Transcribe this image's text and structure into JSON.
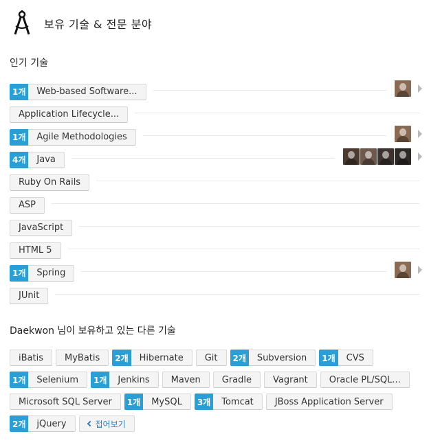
{
  "header": {
    "title": "보유 기술 & 전문 분야",
    "icon": "compass-icon"
  },
  "popular": {
    "heading": "인기 기술",
    "items": [
      {
        "badge": "1개",
        "label": "Web-based Software...",
        "avatars": [
          "#8a6a52"
        ],
        "chevron": true
      },
      {
        "badge": "",
        "label": "Application Lifecycle...",
        "avatars": [],
        "chevron": false
      },
      {
        "badge": "1개",
        "label": "Agile Methodologies",
        "avatars": [
          "#8a6a52"
        ],
        "chevron": true
      },
      {
        "badge": "4개",
        "label": "Java",
        "avatars": [
          "#4a3a30",
          "#6d5a4c",
          "#3c3330",
          "#2e2a28"
        ],
        "chevron": true
      },
      {
        "badge": "",
        "label": "Ruby On Rails",
        "avatars": [],
        "chevron": false
      },
      {
        "badge": "",
        "label": "ASP",
        "avatars": [],
        "chevron": false
      },
      {
        "badge": "",
        "label": "JavaScript",
        "avatars": [],
        "chevron": false
      },
      {
        "badge": "",
        "label": "HTML 5",
        "avatars": [],
        "chevron": false
      },
      {
        "badge": "1개",
        "label": "Spring",
        "avatars": [
          "#8a6a52"
        ],
        "chevron": true
      },
      {
        "badge": "",
        "label": "JUnit",
        "avatars": [],
        "chevron": false
      }
    ]
  },
  "other": {
    "heading": "Daekwon 님이 보유하고 있는 다른 기술",
    "items": [
      {
        "badge": "",
        "label": "iBatis"
      },
      {
        "badge": "",
        "label": "MyBatis"
      },
      {
        "badge": "2개",
        "label": "Hibernate"
      },
      {
        "badge": "",
        "label": "Git"
      },
      {
        "badge": "2개",
        "label": "Subversion"
      },
      {
        "badge": "1개",
        "label": "CVS"
      },
      {
        "badge": "1개",
        "label": "Selenium"
      },
      {
        "badge": "1개",
        "label": "Jenkins"
      },
      {
        "badge": "",
        "label": "Maven"
      },
      {
        "badge": "",
        "label": "Gradle"
      },
      {
        "badge": "",
        "label": "Vagrant"
      },
      {
        "badge": "",
        "label": "Oracle PL/SQL..."
      },
      {
        "badge": "",
        "label": "Microsoft SQL Server"
      },
      {
        "badge": "1개",
        "label": "MySQL"
      },
      {
        "badge": "3개",
        "label": "Tomcat"
      },
      {
        "badge": "",
        "label": "JBoss Application Server"
      },
      {
        "badge": "2개",
        "label": "jQuery"
      }
    ],
    "collapse_label": "접어보기"
  },
  "colors": {
    "badge": "#2a9fd6",
    "link": "#2a7fc0"
  }
}
